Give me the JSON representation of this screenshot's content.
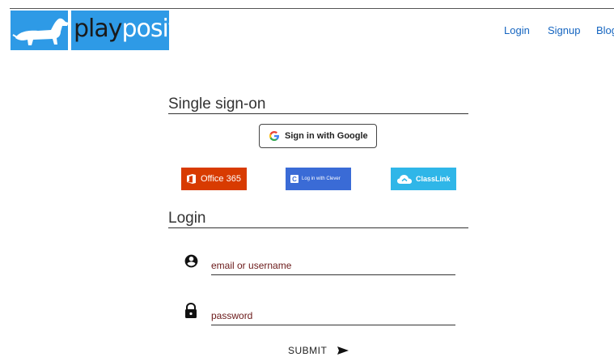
{
  "header": {
    "logo_part1": "play",
    "logo_part2": "posit",
    "nav": [
      {
        "label": "Login"
      },
      {
        "label": "Signup"
      },
      {
        "label": "Blog"
      }
    ]
  },
  "sso": {
    "title": "Single sign-on",
    "google_label": "Sign in with Google",
    "office_label": "Office 365",
    "clever_label": "Log in with Clever",
    "classlink_label": "ClassLink"
  },
  "login": {
    "title": "Login",
    "username_placeholder": "email or username",
    "password_placeholder": "password",
    "submit_label": "SUBMIT"
  },
  "colors": {
    "logo_bg": "#2e9ae6",
    "office": "#d83b01",
    "clever": "#3a6bd6",
    "classlink": "#2fb6e8",
    "link": "#1565c0"
  }
}
